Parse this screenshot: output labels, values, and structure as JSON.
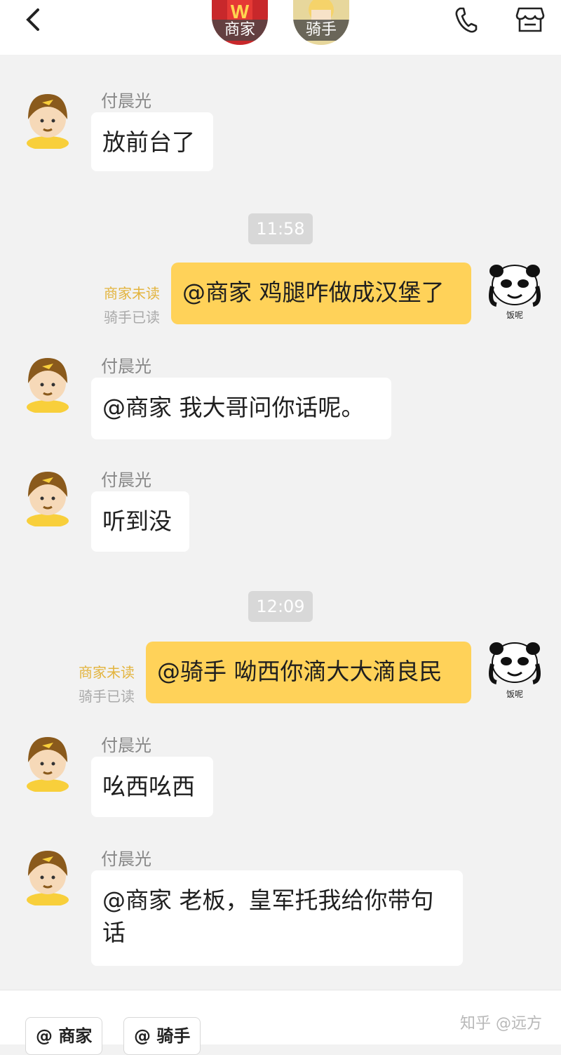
{
  "header": {
    "merchant_tag": "商家",
    "rider_tag": "骑手"
  },
  "messages": [
    {
      "name": "付晨光",
      "text": "放前台了"
    },
    {
      "time": "11:58"
    },
    {
      "text": "@商家 鸡腿咋做成汉堡了",
      "unread": "商家未读",
      "read": "骑手已读",
      "avatar_caption": "饭呢"
    },
    {
      "name": "付晨光",
      "text": "@商家 我大哥问你话呢。"
    },
    {
      "name": "付晨光",
      "text": "听到没"
    },
    {
      "time": "12:09"
    },
    {
      "text": "@骑手 呦西你滴大大滴良民",
      "unread": "商家未读",
      "read": "骑手已读",
      "avatar_caption": "饭呢"
    },
    {
      "name": "付晨光",
      "text": "吆西吆西"
    },
    {
      "name": "付晨光",
      "text": "@商家 老板，皇军托我给你带句话"
    }
  ],
  "bottom": {
    "chips": [
      "@ 商家",
      "@ 骑手"
    ],
    "watermark": "知乎 @远方"
  },
  "colors": {
    "background": "#f2f2f2",
    "bubble_mine": "#ffd259",
    "bubble_other": "#ffffff",
    "status_unread": "#e3b43e"
  }
}
